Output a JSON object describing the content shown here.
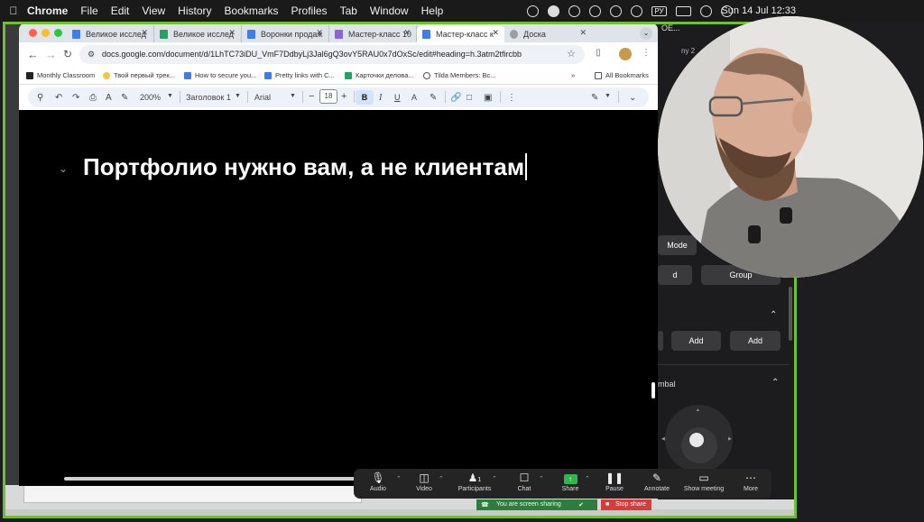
{
  "menubar": {
    "apple": "",
    "app": "Chrome",
    "items": [
      "File",
      "Edit",
      "View",
      "History",
      "Bookmarks",
      "Profiles",
      "Tab",
      "Window",
      "Help"
    ],
    "input_source": "РУ",
    "clock": "Sun 14 Jul  12:33"
  },
  "chrome": {
    "tabs": [
      {
        "label": "Великое исслед",
        "favicon_color": "#3f7ee8"
      },
      {
        "label": "Великое исслед",
        "favicon_color": "#1fa463"
      },
      {
        "label": "Воронки продаж",
        "favicon_color": "#3f7ee8"
      },
      {
        "label": "Мастер-класс 10",
        "favicon_color": "#8e62d8"
      },
      {
        "label": "Мастер-класс к",
        "favicon_color": "#3f7ee8"
      },
      {
        "label": "Доска",
        "favicon_color": "#9aa0a6"
      }
    ],
    "url": "docs.google.com/document/d/1LhTC73iDU_VmF7DdbyLj3Jal6gQ3ovY5RAU0x7dOxSc/edit#heading=h.3atm2tfircbb",
    "bookmarks": [
      {
        "label": "Monthly Classroom",
        "favicon_color": "#222"
      },
      {
        "label": "Твой первый трек...",
        "favicon_color": "#f2c744"
      },
      {
        "label": "How to secure you...",
        "favicon_color": "#3f7ee8"
      },
      {
        "label": "Pretty links with C...",
        "favicon_color": "#3f7ee8"
      },
      {
        "label": "Карточки деловa...",
        "favicon_color": "#1fa463"
      },
      {
        "label": "Tilda Members: Вс...",
        "favicon_color": "#555"
      }
    ],
    "bookmarks_overflow": "»",
    "all_bookmarks": "All Bookmarks"
  },
  "docs_toolbar": {
    "zoom": "200%",
    "style": "Заголовок 1",
    "font": "Arial",
    "font_size": "18",
    "bold": "B",
    "italic": "I",
    "underline": "U",
    "text_color": "A",
    "minus": "−",
    "plus": "+"
  },
  "document": {
    "heading": "Портфолио нужно вам, а не клиентам"
  },
  "zoom_panel": {
    "title": "ОЕ...",
    "subtitle": "ny 2",
    "btn_mode": "Mode",
    "btn_d": "d",
    "btn_group": "Group",
    "add1": "Add",
    "add2": "Add",
    "gimbal": "mbal"
  },
  "zoom_bar": {
    "audio": "Audio",
    "video": "Video",
    "participants": "Participants",
    "participants_count": "1",
    "chat": "Chat",
    "share": "Share",
    "pause": "Pause",
    "annotate": "Annotate",
    "show_meeting": "Show meeting",
    "more": "More"
  },
  "share_status": {
    "text": "You are screen sharing",
    "stop": "Stop share"
  },
  "colors": {
    "share_frame": "#6fbf2e",
    "stop_share": "#d83b3b",
    "share_green": "#2db84c"
  }
}
